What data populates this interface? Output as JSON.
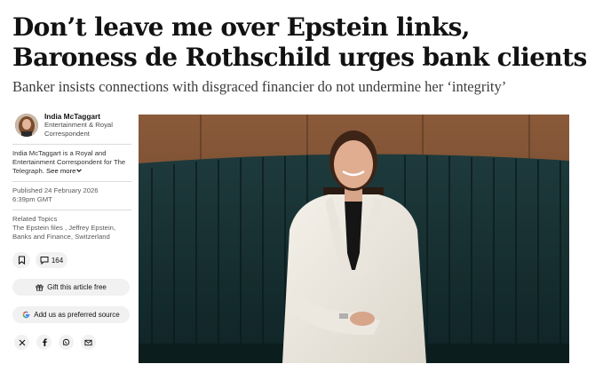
{
  "article": {
    "headline": "Don’t leave me over Epstein links, Baroness de Rothschild urges bank clients",
    "standfirst": "Banker insists connections with disgraced financier do not undermine her ‘integrity’"
  },
  "author": {
    "name": "India McTaggart",
    "role": "Entertainment & Royal Correspondent",
    "bio": "India McTaggart is a Royal and Entertainment Correspondent for The Telegraph.",
    "see_more": "See more"
  },
  "published": {
    "line1": "Published 24 February 2026",
    "line2": "6:39pm GMT"
  },
  "related": {
    "heading": "Related Topics",
    "topics": "The Epstein files , Jeffrey Epstein, Banks and Finance, Switzerland"
  },
  "actions": {
    "comment_count": "164",
    "gift_label": "Gift this article free",
    "google_label": "Add us as preferred source"
  },
  "icons": [
    "bookmark-icon",
    "comment-icon",
    "gift-icon",
    "google-icon",
    "x-icon",
    "facebook-icon",
    "whatsapp-icon",
    "email-icon"
  ],
  "colors": {
    "text": "#121212",
    "pill_bg": "#f1f1f1",
    "google_blue": "#4285F4",
    "google_red": "#EA4335",
    "google_yellow": "#FBBC05",
    "google_green": "#34A853"
  }
}
